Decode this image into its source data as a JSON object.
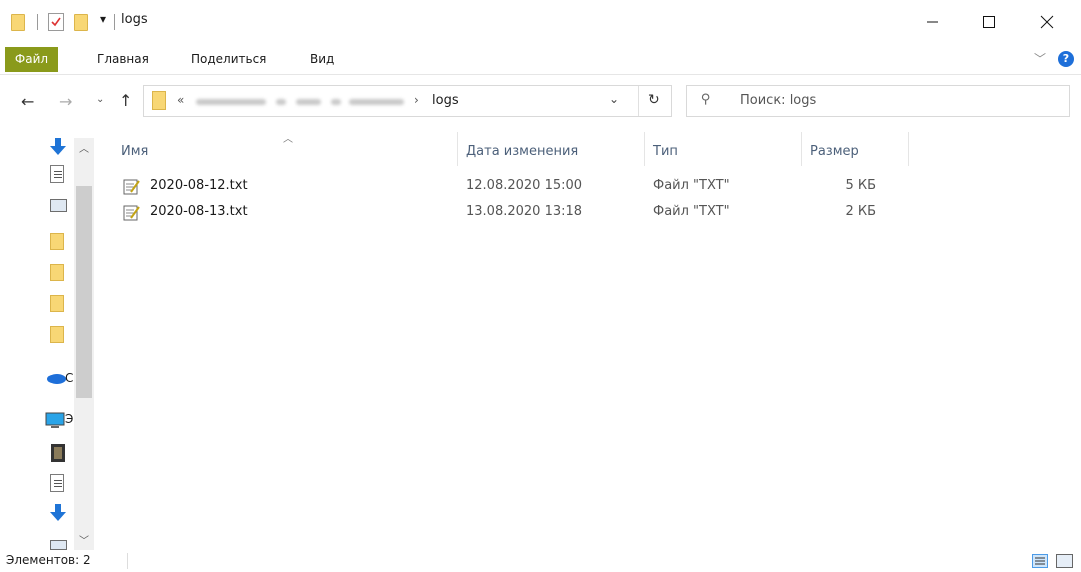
{
  "window": {
    "title": "logs"
  },
  "ribbon": {
    "tabs": [
      "Файл",
      "Главная",
      "Поделиться",
      "Вид"
    ]
  },
  "address": {
    "prefix": "«",
    "current": "logs"
  },
  "search": {
    "placeholder": "Поиск: logs"
  },
  "columns": {
    "name": "Имя",
    "date": "Дата изменения",
    "type": "Тип",
    "size": "Размер"
  },
  "files": [
    {
      "name": "2020-08-12.txt",
      "date": "12.08.2020 15:00",
      "type": "Файл \"TXT\"",
      "size": "5 КБ"
    },
    {
      "name": "2020-08-13.txt",
      "date": "13.08.2020 13:18",
      "type": "Файл \"TXT\"",
      "size": "2 КБ"
    }
  ],
  "navpane": {
    "onedrive_label": "C",
    "pc_label": "Э"
  },
  "status": {
    "items": "Элементов: 2"
  },
  "colors": {
    "file_tab": "#8a9a1b",
    "header_text": "#4c607a",
    "folder": "#f8d775",
    "onedrive": "#1e6fd9"
  }
}
